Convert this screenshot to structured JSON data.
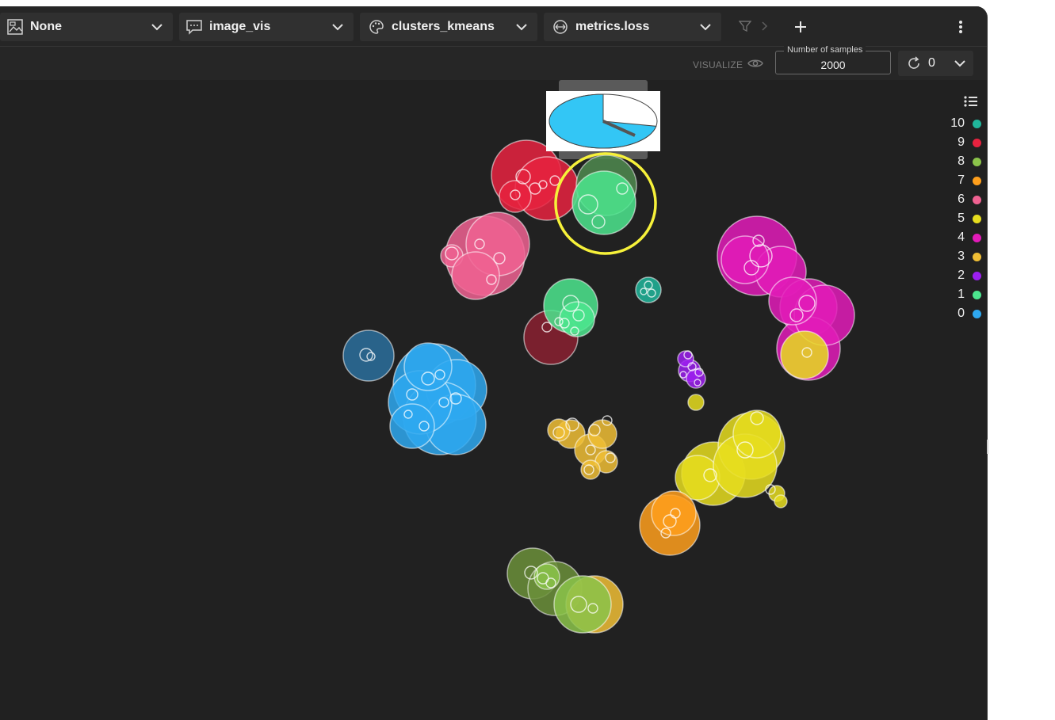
{
  "toolbar": {
    "dropdowns": [
      {
        "name": "image-source",
        "label": "None",
        "icon": "image-icon"
      },
      {
        "name": "caption-source",
        "label": "image_vis",
        "icon": "comment-icon"
      },
      {
        "name": "color-source",
        "label": "clusters_kmeans",
        "icon": "palette-icon"
      },
      {
        "name": "size-source",
        "label": "metrics.loss",
        "icon": "size-icon"
      }
    ],
    "filter_icon": "filter-icon",
    "add_icon": "plus-icon",
    "menu_icon": "more-vertical-icon"
  },
  "subbar": {
    "visualize_label": "VISUALIZE",
    "samples_label": "Number of samples",
    "samples_value": "2000",
    "refresh_value": "0"
  },
  "legend": {
    "items": [
      {
        "label": "10",
        "color": "#20b69b"
      },
      {
        "label": "9",
        "color": "#e8223f"
      },
      {
        "label": "8",
        "color": "#8bc34a"
      },
      {
        "label": "7",
        "color": "#ff9f1c"
      },
      {
        "label": "6",
        "color": "#f06292"
      },
      {
        "label": "5",
        "color": "#e6dd1e"
      },
      {
        "label": "4",
        "color": "#e21bb9"
      },
      {
        "label": "3",
        "color": "#f0be35"
      },
      {
        "label": "2",
        "color": "#9c1ff0"
      },
      {
        "label": "1",
        "color": "#4ce68e"
      },
      {
        "label": "0",
        "color": "#2ea8f0"
      }
    ]
  },
  "tooltip": {
    "pie_fraction": 0.72
  }
}
